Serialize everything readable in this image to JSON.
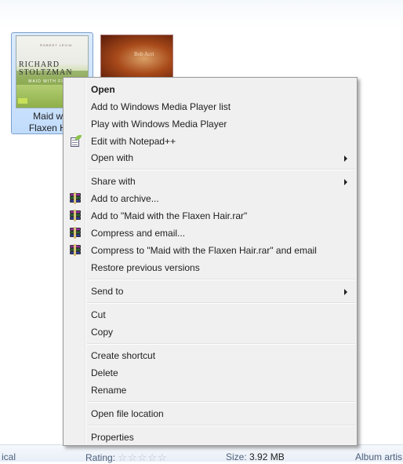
{
  "explorer": {
    "files": [
      {
        "label_line1": "Maid with",
        "label_line2": "Flaxen Hair",
        "art_top": "ROBERT LEVIN",
        "art_title": "RICHARD STOLTZMAN",
        "art_sub": "MAID WITH FLAXEN",
        "selected": true
      },
      {
        "label_line1": "",
        "label_line2": "",
        "art_text": "Bob Acri",
        "selected": false
      }
    ]
  },
  "context_menu": {
    "items": [
      {
        "label": "Open",
        "bold": true
      },
      {
        "label": "Add to Windows Media Player list"
      },
      {
        "label": "Play with Windows Media Player"
      },
      {
        "label": "Edit with Notepad++",
        "icon": "notepad-plus-plus-icon"
      },
      {
        "label": "Open with",
        "submenu": true
      },
      {
        "label": "Share with",
        "submenu": true
      },
      {
        "label": "Add to archive...",
        "icon": "winrar-icon"
      },
      {
        "label": "Add to \"Maid with the Flaxen Hair.rar\"",
        "icon": "winrar-icon"
      },
      {
        "label": "Compress and email...",
        "icon": "winrar-icon"
      },
      {
        "label": "Compress to \"Maid with the Flaxen Hair.rar\" and email",
        "icon": "winrar-icon"
      },
      {
        "label": "Restore previous versions"
      },
      {
        "label": "Send to",
        "submenu": true
      },
      {
        "label": "Cut"
      },
      {
        "label": "Copy"
      },
      {
        "label": "Create shortcut"
      },
      {
        "label": "Delete"
      },
      {
        "label": "Rename"
      },
      {
        "label": "Open file location"
      },
      {
        "label": "Properties"
      }
    ]
  },
  "details": {
    "genre_partial": "ical",
    "rating_label": "Rating:",
    "rating_stars": "☆☆☆☆☆",
    "size_label": "Size:",
    "size_value": "3.92 MB",
    "album_artist_partial": "Album artis"
  }
}
